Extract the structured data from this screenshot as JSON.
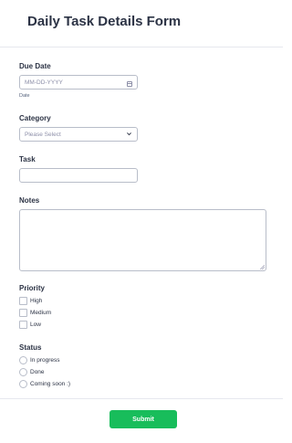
{
  "form": {
    "title": "Daily Task Details Form"
  },
  "due_date": {
    "label": "Due Date",
    "placeholder": "MM-DD-YYYY",
    "sublabel": "Date",
    "icon": "calendar-icon"
  },
  "category": {
    "label": "Category",
    "selected": "Please Select",
    "icon": "chevron-down-icon"
  },
  "task": {
    "label": "Task",
    "value": ""
  },
  "notes": {
    "label": "Notes",
    "value": ""
  },
  "priority": {
    "label": "Priority",
    "options": [
      "High",
      "Medium",
      "Low"
    ]
  },
  "status": {
    "label": "Status",
    "options": [
      "In progress",
      "Done",
      "Coming soon :)"
    ]
  },
  "submit": {
    "label": "Submit",
    "color": "#18bd5b"
  }
}
